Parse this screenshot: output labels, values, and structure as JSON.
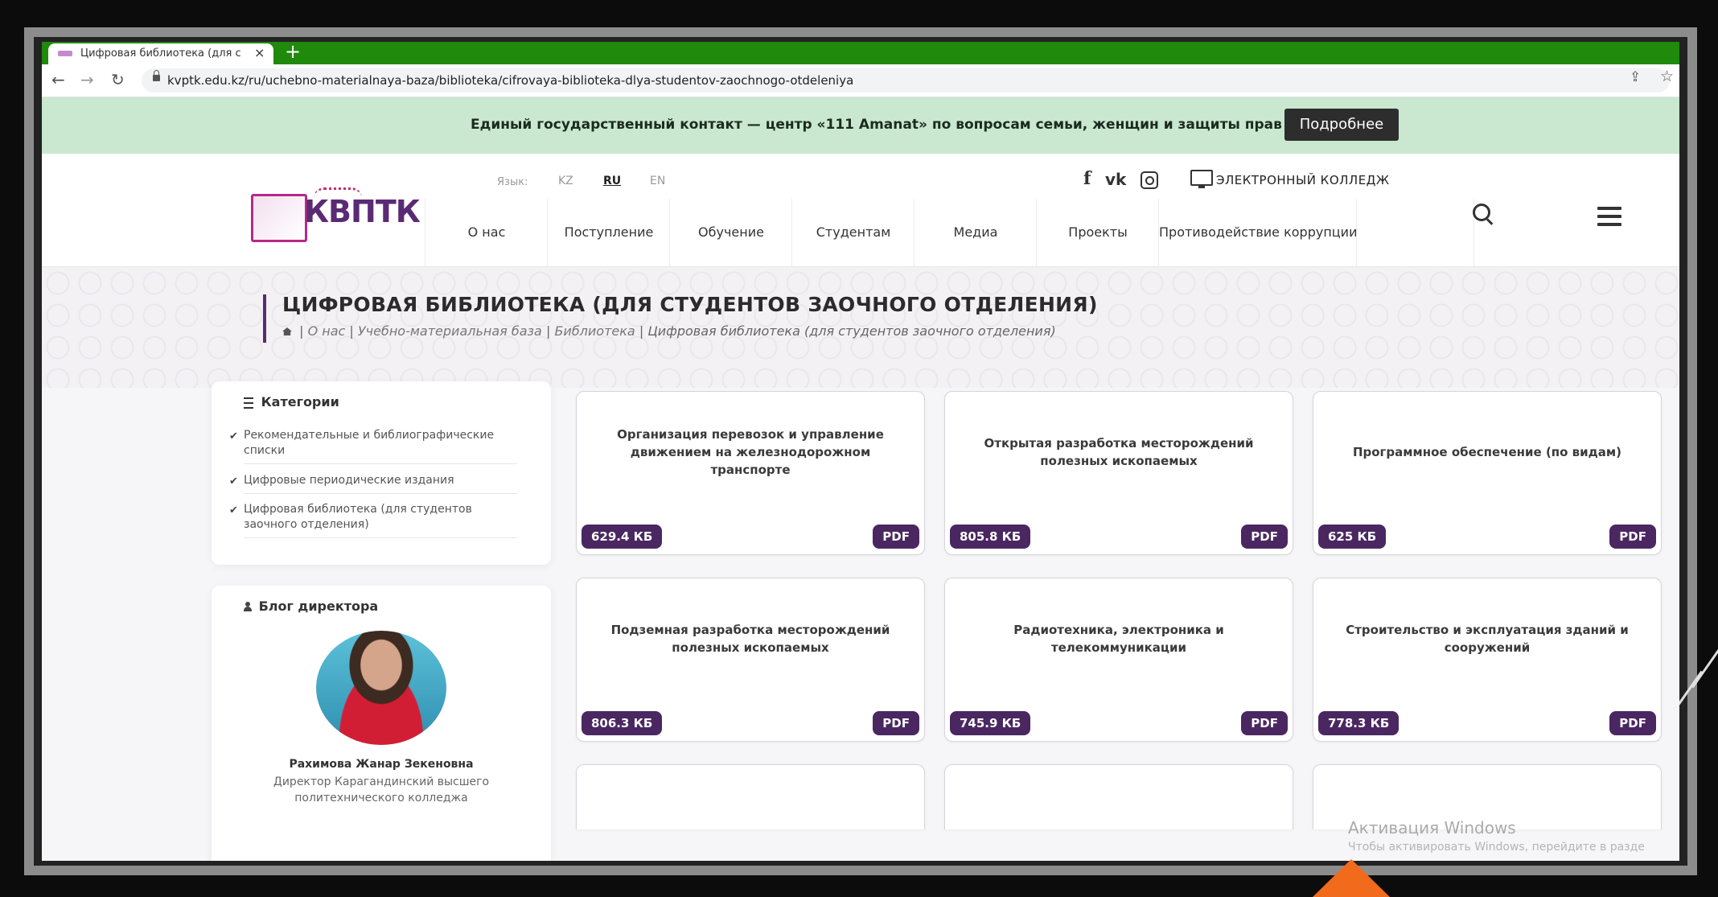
{
  "tab": {
    "title": "Цифровая библиотека (для сту",
    "close": "×",
    "new": "+"
  },
  "address": {
    "url": "kvptk.edu.kz/ru/uchebno-materialnaya-baza/biblioteka/cifrovaya-biblioteka-dlya-studentov-zaochnogo-otdeleniya",
    "back": "←",
    "forward": "→",
    "reload": "↻",
    "share": "⇪",
    "star": "☆"
  },
  "notice": {
    "text": "Единый государственный контакт — центр «111 Amanat» по вопросам семьи, женщин и защиты прав детей",
    "button": "Подробнее"
  },
  "header": {
    "lang_label": "Язык:",
    "langs": [
      "KZ",
      "RU",
      "EN"
    ],
    "social": {
      "facebook": "f",
      "vk": "vk"
    },
    "ecollege": "ЭЛЕКТРОННЫЙ КОЛЛЕДЖ",
    "logo_text": "КВПТК",
    "menu": [
      "О нас",
      "Поступление",
      "Обучение",
      "Студентам",
      "Медиа",
      "Проекты",
      "Противодействие коррупции"
    ]
  },
  "page": {
    "title": "ЦИФРОВАЯ БИБЛИОТЕКА (ДЛЯ СТУДЕНТОВ ЗАОЧНОГО ОТДЕЛЕНИЯ)",
    "breadcrumb": [
      "О нас",
      "Учебно-материальная база",
      "Библиотека",
      "Цифровая библиотека (для студентов заочного отделения)"
    ],
    "sep": "|"
  },
  "sidebar": {
    "categories_title": "Категории",
    "categories": [
      "Рекомендательные и библиографические списки",
      "Цифровые периодические издания",
      "Цифровая библиотека (для студентов заочного отделения)"
    ],
    "blog_title": "Блог директора",
    "director_name": "Рахимова Жанар Зекеновна",
    "director_role": "Директор Карагандинский высшего политехнического колледжа"
  },
  "files": [
    {
      "title": "Организация перевозок и управление движением на железнодорожном транспорте",
      "size": "629.4 КБ",
      "type": "PDF"
    },
    {
      "title": "Открытая разработка месторождений полезных ископаемых",
      "size": "805.8 КБ",
      "type": "PDF"
    },
    {
      "title": "Программное обеспечение (по видам)",
      "size": "625 КБ",
      "type": "PDF"
    },
    {
      "title": "Подземная разработка месторождений полезных ископаемых",
      "size": "806.3 КБ",
      "type": "PDF"
    },
    {
      "title": "Радиотехника, электроника и телекоммуникации",
      "size": "745.9 КБ",
      "type": "PDF"
    },
    {
      "title": "Строительство и эксплуатация зданий и сооружений",
      "size": "778.3 КБ",
      "type": "PDF"
    }
  ],
  "watermark": {
    "title": "Активация Windows",
    "subtitle": "Чтобы активировать Windows, перейдите в разде"
  }
}
